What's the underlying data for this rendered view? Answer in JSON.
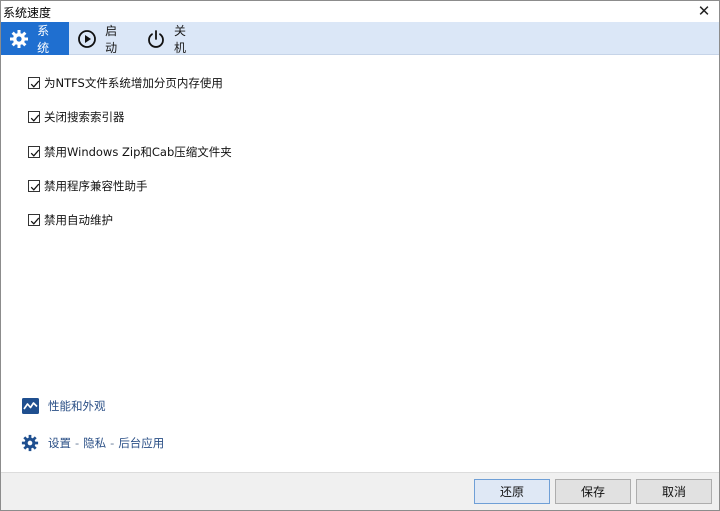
{
  "window": {
    "title": "系统速度",
    "close_glyph": "✕"
  },
  "tabs": [
    {
      "label": "系统",
      "icon": "gear-icon",
      "active": true
    },
    {
      "label": "启动",
      "icon": "play-circle-icon",
      "active": false
    },
    {
      "label": "关机",
      "icon": "power-icon",
      "active": false
    }
  ],
  "options": [
    {
      "label": "为NTFS文件系统增加分页内存使用",
      "checked": true
    },
    {
      "label": "关闭搜索索引器",
      "checked": true
    },
    {
      "label": "禁用Windows Zip和Cab压缩文件夹",
      "checked": true
    },
    {
      "label": "禁用程序兼容性助手",
      "checked": true
    },
    {
      "label": "禁用自动维护",
      "checked": true
    }
  ],
  "links": {
    "performance": {
      "label": "性能和外观",
      "icon": "performance-chart-icon"
    },
    "settings": {
      "icon": "gear-icon",
      "part1": "设置",
      "sep": "-",
      "part2": "隐私",
      "part3": "后台应用"
    }
  },
  "footer": {
    "restore_label": "还原",
    "save_label": "保存",
    "cancel_label": "取消"
  },
  "colors": {
    "tab_bar_bg": "#dbe7f7",
    "active_tab_bg": "#1f6fd0",
    "link_text": "#2a4f86",
    "icon_blue": "#1f4f8f"
  }
}
